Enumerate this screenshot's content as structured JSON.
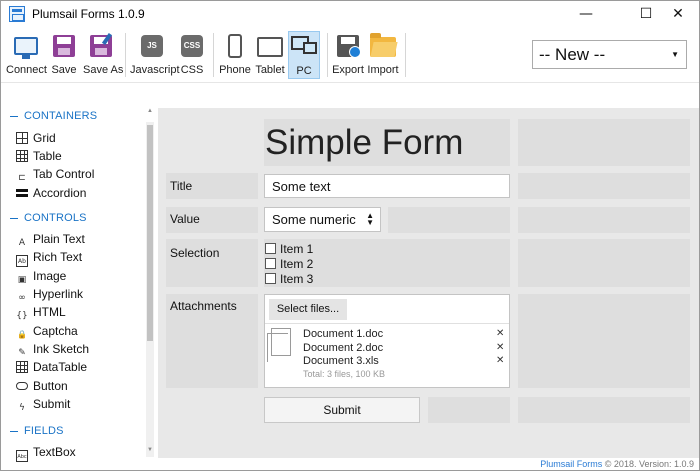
{
  "window": {
    "title": "Plumsail Forms 1.0.9",
    "minimize": "—",
    "maximize": "☐",
    "close": "✕"
  },
  "toolbar": {
    "connect": "Connect",
    "save": "Save",
    "save_as": "Save As",
    "javascript": "Javascript",
    "javascript_icon_text": "JS",
    "css": "CSS",
    "css_icon_text": "CSS",
    "phone": "Phone",
    "tablet": "Tablet",
    "pc": "PC",
    "export": "Export",
    "import": "Import",
    "active_device": "PC"
  },
  "form_select": {
    "value": "-- New --",
    "arrow": "▼"
  },
  "sidebar": {
    "containers_header": "CONTAINERS",
    "containers": [
      {
        "label": "Grid",
        "icon": "grid-icon"
      },
      {
        "label": "Table",
        "icon": "table-icon"
      },
      {
        "label": "Tab Control",
        "icon": "tab-control-icon"
      },
      {
        "label": "Accordion",
        "icon": "accordion-icon"
      }
    ],
    "controls_header": "CONTROLS",
    "controls": [
      {
        "label": "Plain Text",
        "icon": "plain-text-icon",
        "glyph": "A"
      },
      {
        "label": "Rich Text",
        "icon": "rich-text-icon",
        "glyph": "Ab"
      },
      {
        "label": "Image",
        "icon": "image-icon",
        "glyph": "▣"
      },
      {
        "label": "Hyperlink",
        "icon": "hyperlink-icon",
        "glyph": "∞"
      },
      {
        "label": "HTML",
        "icon": "html-icon",
        "glyph": "{}"
      },
      {
        "label": "Captcha",
        "icon": "captcha-icon",
        "glyph": "🔒"
      },
      {
        "label": "Ink Sketch",
        "icon": "ink-sketch-icon",
        "glyph": "✎"
      },
      {
        "label": "DataTable",
        "icon": "datatable-icon",
        "glyph": ""
      },
      {
        "label": "Button",
        "icon": "button-icon",
        "glyph": ""
      },
      {
        "label": "Submit",
        "icon": "submit-icon",
        "glyph": "ϟ"
      }
    ],
    "fields_header": "FIELDS",
    "fields": [
      {
        "label": "TextBox",
        "icon": "textbox-icon",
        "glyph": "Abc"
      }
    ],
    "scroll_up": "▲",
    "scroll_down": "▼"
  },
  "form": {
    "title": "Simple Form",
    "title_label": "Title",
    "title_value": "Some text",
    "value_label": "Value",
    "value_value": "Some numeric",
    "spin_up": "▲",
    "spin_down": "▼",
    "selection_label": "Selection",
    "selection_items": [
      "Item 1",
      "Item 2",
      "Item 3"
    ],
    "attachments_label": "Attachments",
    "select_files": "Select files...",
    "files": [
      "Document 1.doc",
      "Document 2.doc",
      "Document 3.xls"
    ],
    "remove_glyph": "✕",
    "total": "Total: 3 files, 100 KB",
    "submit": "Submit"
  },
  "footer": {
    "brand": "Plumsail Forms",
    "text": " © 2018. Version: 1.0.9"
  }
}
